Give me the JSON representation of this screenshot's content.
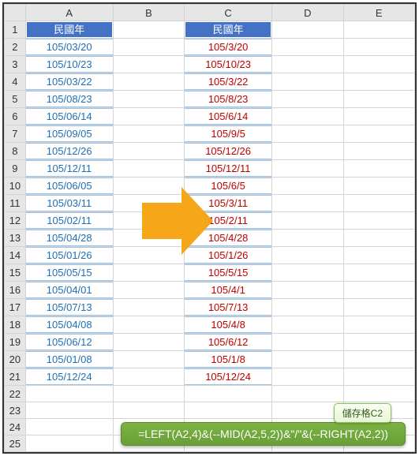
{
  "columns": [
    "A",
    "B",
    "C",
    "D",
    "E"
  ],
  "rowCount": 25,
  "header": {
    "A": "民國年",
    "C": "民國年"
  },
  "colA": [
    "105/03/20",
    "105/10/23",
    "105/03/22",
    "105/08/23",
    "105/06/14",
    "105/09/05",
    "105/12/26",
    "105/12/11",
    "105/06/05",
    "105/03/11",
    "105/02/11",
    "105/04/28",
    "105/01/26",
    "105/05/15",
    "105/04/01",
    "105/07/13",
    "105/04/08",
    "105/06/12",
    "105/01/08",
    "105/12/24"
  ],
  "colC": [
    "105/3/20",
    "105/10/23",
    "105/3/22",
    "105/8/23",
    "105/6/14",
    "105/9/5",
    "105/12/26",
    "105/12/11",
    "105/6/5",
    "105/3/11",
    "105/2/11",
    "105/4/28",
    "105/1/26",
    "105/5/15",
    "105/4/1",
    "105/7/13",
    "105/4/8",
    "105/6/12",
    "105/1/8",
    "105/12/24"
  ],
  "formula": {
    "label": "儲存格C2",
    "text": "=LEFT(A2,4)&(--MID(A2,5,2))&\"/\"&(--RIGHT(A2,2))"
  },
  "arrow": {
    "color": "#F6A619"
  }
}
